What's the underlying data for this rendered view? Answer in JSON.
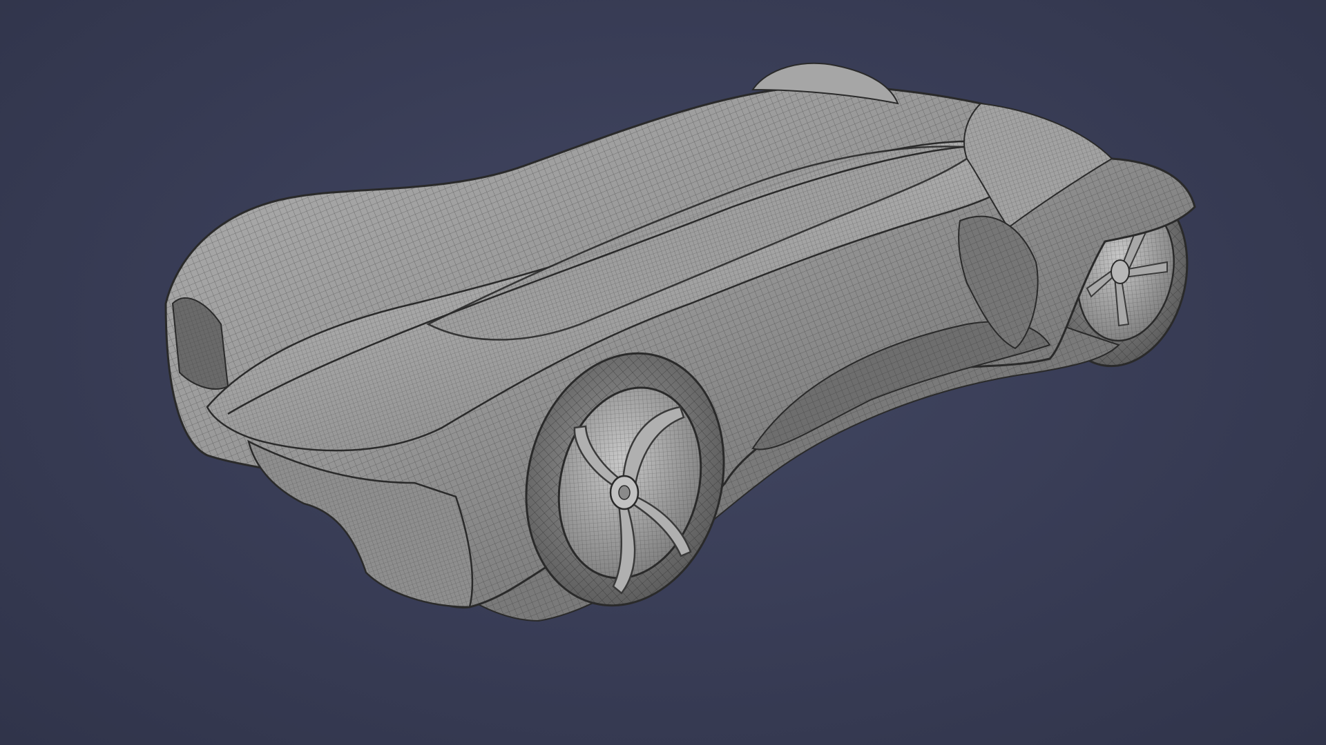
{
  "viewport": {
    "background_color": "#383c55",
    "render_mode": "wireframe-on-shaded",
    "subject": "car-body-mesh"
  },
  "colors": {
    "mesh_fill": "#8a8a8a",
    "mesh_highlight": "#b4b4b4",
    "mesh_shadow": "#4a4a4a",
    "wire": "#2e2e2e"
  }
}
